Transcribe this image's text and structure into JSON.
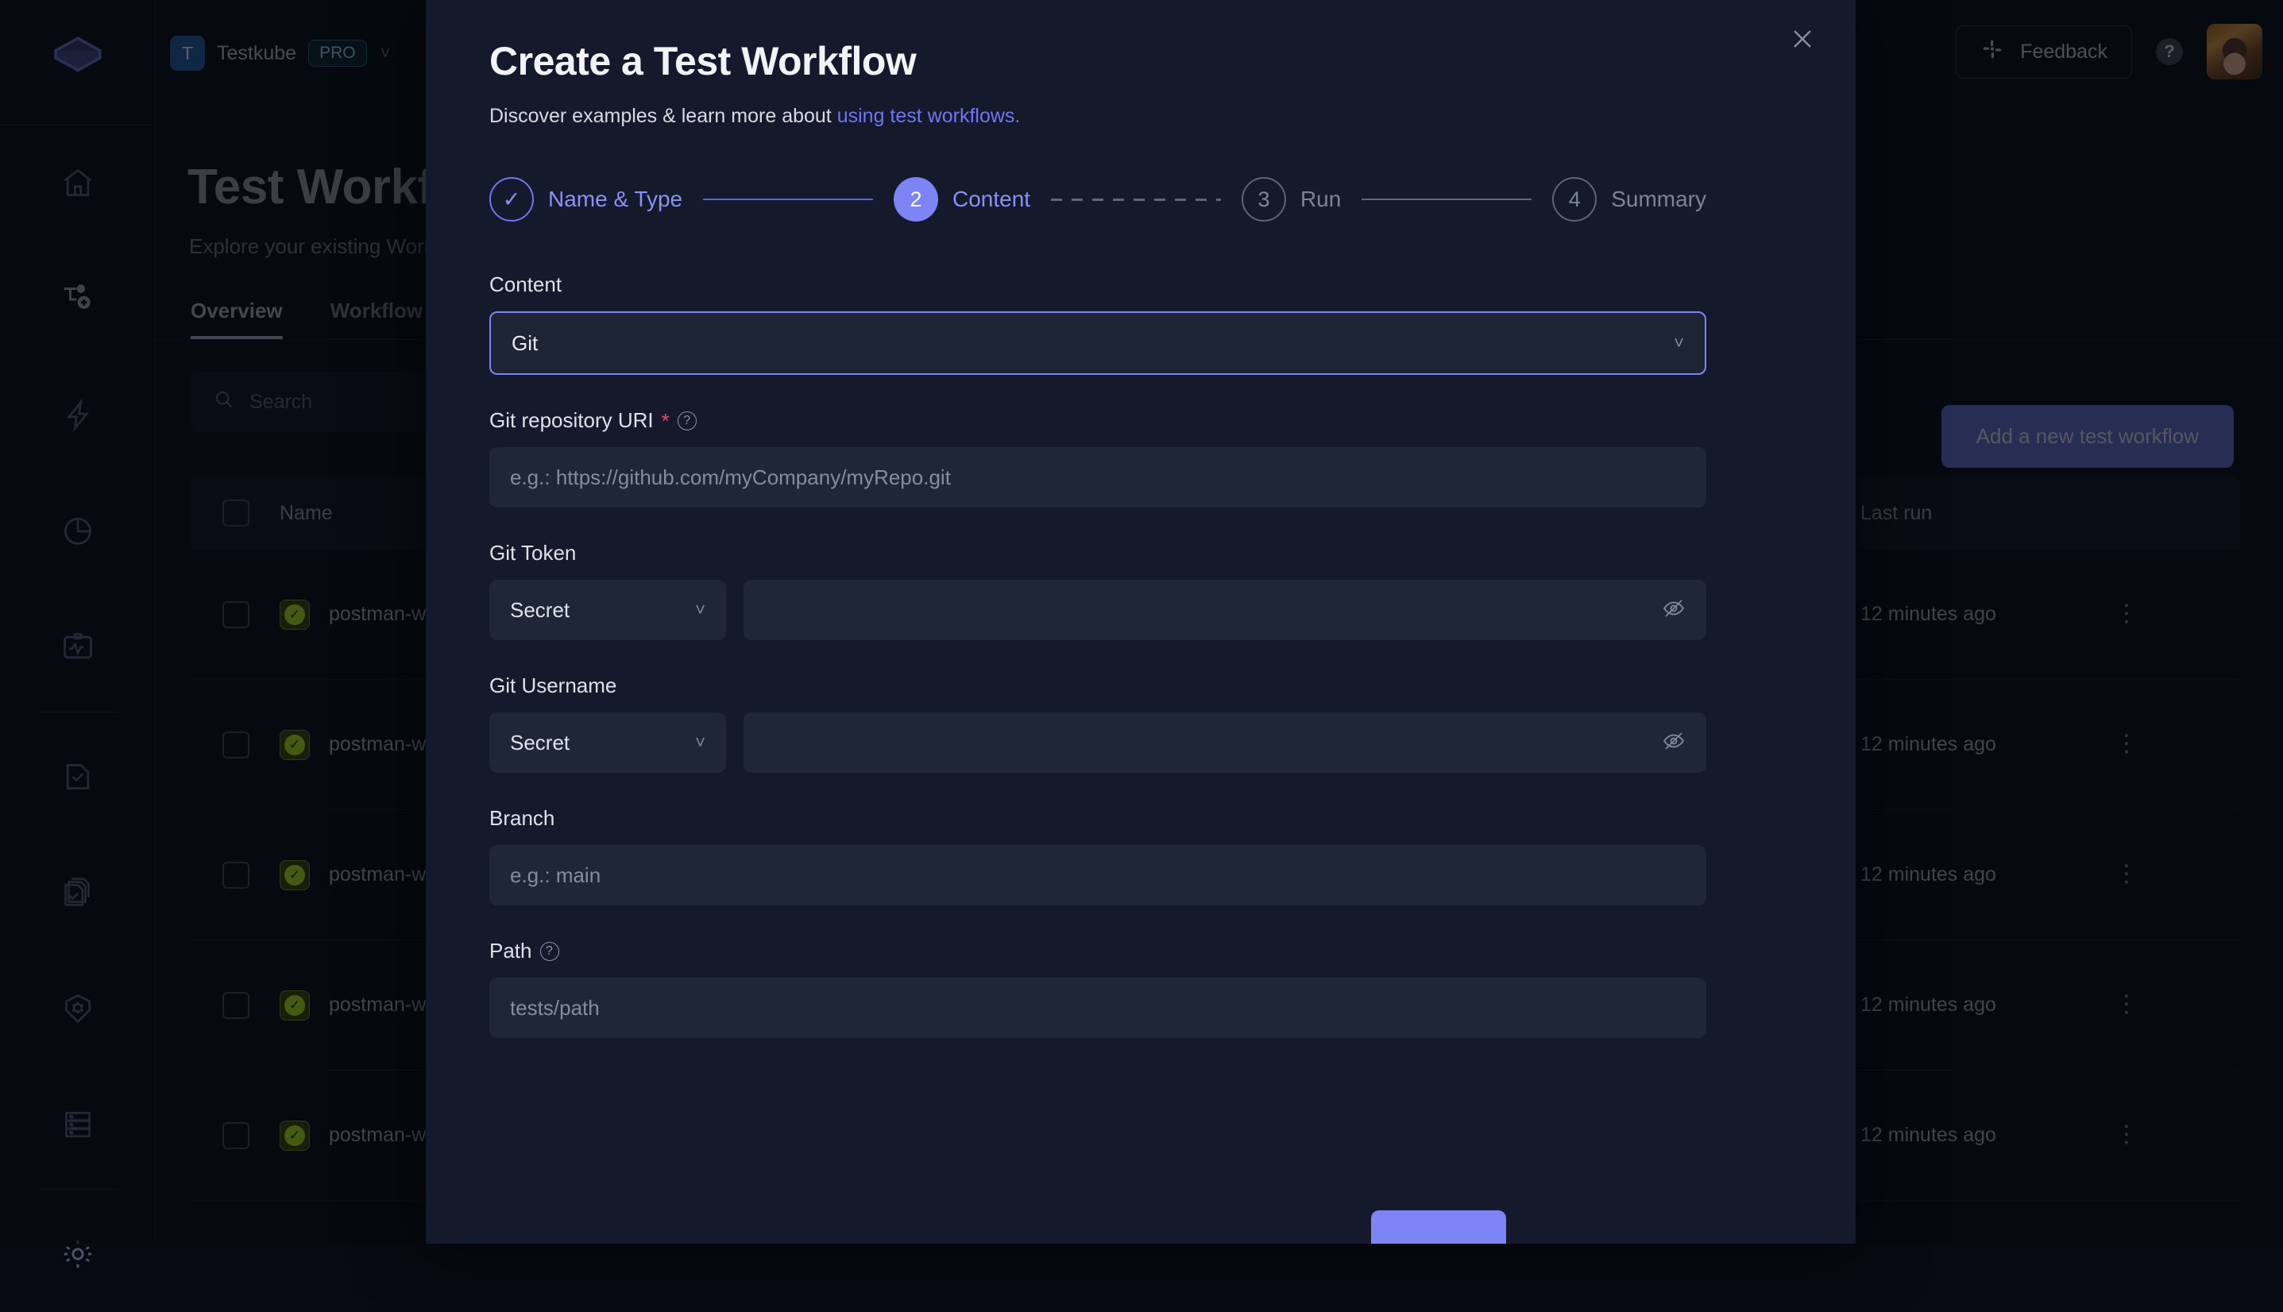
{
  "topbar": {
    "org_initial": "T",
    "org_name": "Testkube",
    "org_plan": "PRO",
    "caret": "chevron-down",
    "feedback_label": "Feedback",
    "help_label": "?"
  },
  "sidebar": {
    "items": [
      {
        "name": "logo",
        "icon": "testkube-cube-icon"
      },
      {
        "name": "home",
        "icon": "home-icon"
      },
      {
        "name": "add-workflow",
        "icon": "workflow-add-icon"
      },
      {
        "name": "triggers",
        "icon": "lightning-icon"
      },
      {
        "name": "insights",
        "icon": "pie-chart-icon"
      },
      {
        "name": "status",
        "icon": "monitor-pulse-icon"
      },
      {
        "name": "tests",
        "icon": "file-check-icon"
      },
      {
        "name": "test-suites",
        "icon": "files-check-icon"
      },
      {
        "name": "sources",
        "icon": "shield-gear-icon"
      },
      {
        "name": "environments",
        "icon": "server-icon"
      },
      {
        "name": "settings",
        "icon": "gear-icon"
      }
    ]
  },
  "page": {
    "title": "Test Workflows",
    "subtitle": "Explore your existing Workflows",
    "tabs": [
      {
        "label": "Overview",
        "active": true
      },
      {
        "label": "Workflow Templates",
        "active": false
      }
    ],
    "search_placeholder": "Search",
    "add_button": "Add a new test workflow",
    "table": {
      "columns": [
        "Name",
        "Last run"
      ],
      "rows": [
        {
          "name": "postman-workflow",
          "status": "passed",
          "last_run": "12 minutes ago"
        },
        {
          "name": "postman-workflow",
          "status": "passed",
          "last_run": "12 minutes ago"
        },
        {
          "name": "postman-workflow",
          "status": "passed",
          "last_run": "12 minutes ago"
        },
        {
          "name": "postman-workflow",
          "status": "passed",
          "last_run": "12 minutes ago"
        },
        {
          "name": "postman-workflow",
          "status": "passed",
          "last_run": "12 minutes ago"
        }
      ]
    }
  },
  "modal": {
    "title": "Create a Test Workflow",
    "desc_prefix": "Discover examples & learn more about ",
    "desc_link": "using test workflows.",
    "close_icon": "close-icon",
    "steps": [
      {
        "marker": "✓",
        "label": "Name & Type",
        "state": "done"
      },
      {
        "marker": "2",
        "label": "Content",
        "state": "current"
      },
      {
        "marker": "3",
        "label": "Run",
        "state": "todo"
      },
      {
        "marker": "4",
        "label": "Summary",
        "state": "todo"
      }
    ],
    "form": {
      "content_label": "Content",
      "content_value": "Git",
      "repo_label": "Git repository URI",
      "repo_required": "*",
      "repo_placeholder": "e.g.: https://github.com/myCompany/myRepo.git",
      "token_label": "Git Token",
      "token_source": "Secret",
      "token_value": "",
      "username_label": "Git Username",
      "username_source": "Secret",
      "username_value": "",
      "branch_label": "Branch",
      "branch_placeholder": "e.g.: main",
      "path_label": "Path",
      "path_placeholder": "tests/path"
    }
  },
  "colors": {
    "accent": "#7d84f5",
    "link": "#6f76f0",
    "modal_bg": "#141a2b",
    "page_bg": "#0a0e18",
    "input_bg": "#1e2637",
    "required": "#e8486c",
    "success": "#93c11e"
  }
}
